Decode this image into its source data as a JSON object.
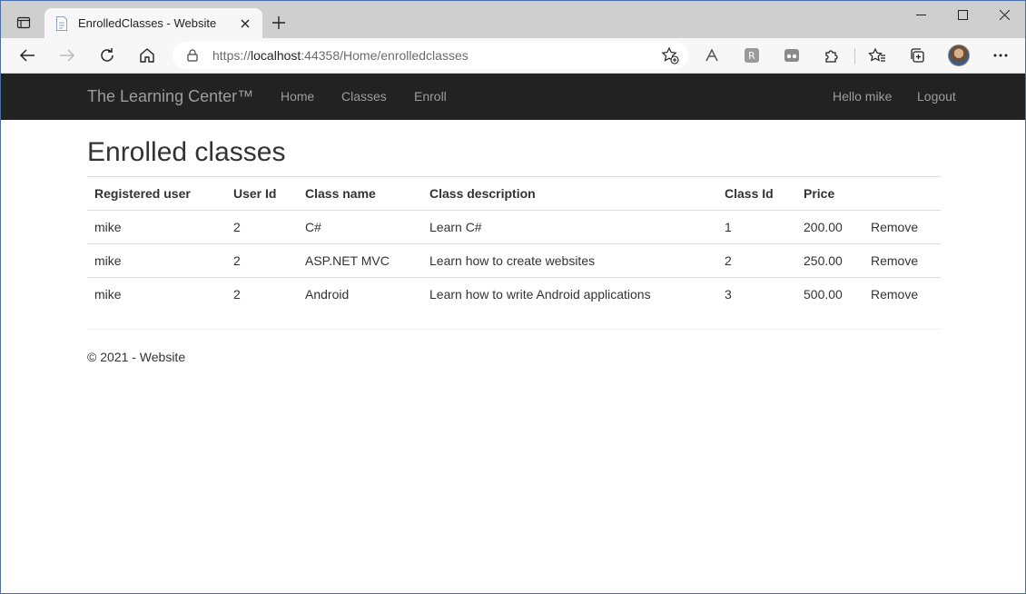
{
  "browser": {
    "tab_title": "EnrolledClasses - Website",
    "url_prefix": "https://",
    "url_host": "localhost",
    "url_rest": ":44358/Home/enrolledclasses"
  },
  "navbar": {
    "brand": "The Learning Center™",
    "links": [
      "Home",
      "Classes",
      "Enroll"
    ],
    "greeting": "Hello mike",
    "logout": "Logout"
  },
  "page": {
    "title": "Enrolled classes"
  },
  "table": {
    "headers": [
      "Registered user",
      "User Id",
      "Class name",
      "Class description",
      "Class Id",
      "Price",
      ""
    ],
    "rows": [
      [
        "mike",
        "2",
        "C#",
        "Learn C#",
        "1",
        "200.00",
        "Remove"
      ],
      [
        "mike",
        "2",
        "ASP.NET MVC",
        "Learn how to create websites",
        "2",
        "250.00",
        "Remove"
      ],
      [
        "mike",
        "2",
        "Android",
        "Learn how to write Android applications",
        "3",
        "500.00",
        "Remove"
      ]
    ]
  },
  "footer": {
    "text": "© 2021 - Website"
  },
  "colors": {
    "navbar_bg": "#222222",
    "navbar_text": "#9d9d9d",
    "tabstrip_bg": "#cfcfcf"
  }
}
